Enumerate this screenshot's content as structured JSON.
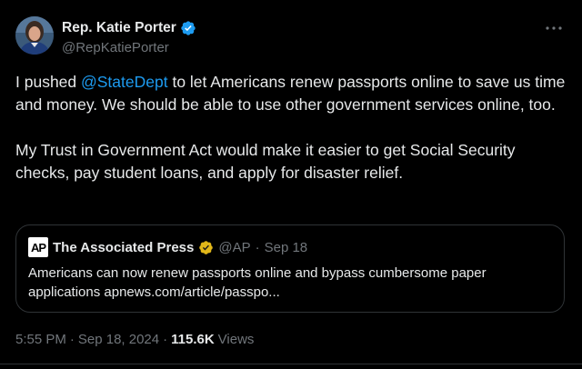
{
  "author": {
    "display_name": "Rep. Katie Porter",
    "handle": "@RepKatiePorter",
    "avatar": "profile-photo",
    "verified_icon": "verified-badge-icon",
    "verified_color": "#1d9bf0"
  },
  "more_icon": "more-options-icon",
  "body": {
    "p1_prefix": "I pushed ",
    "p1_mention": "@StateDept",
    "p1_suffix": " to let Americans renew passports online to save us time and money. We should be able to use other government services online, too.",
    "p2": "My Trust in Government Act would make it easier to get Social Security checks, pay student loans, and apply for disaster relief."
  },
  "quote": {
    "logo_text": "AP",
    "name": "The Associated Press",
    "badge_icon": "gold-verified-badge-icon",
    "badge_color": "#e2b719",
    "handle": "@AP",
    "separator": "·",
    "date": "Sep 18",
    "text": "Americans can now renew passports online and bypass cumbersome paper applications apnews.com/article/passpo..."
  },
  "footer": {
    "time": "5:55 PM",
    "separator1": "·",
    "date": "Sep 18, 2024",
    "separator2": "·",
    "views_count": "115.6K",
    "views_label": "Views"
  },
  "colors": {
    "background": "#000000",
    "text": "#e7e9ea",
    "muted": "#71767b",
    "link": "#1d9bf0",
    "border": "#2f3336"
  }
}
